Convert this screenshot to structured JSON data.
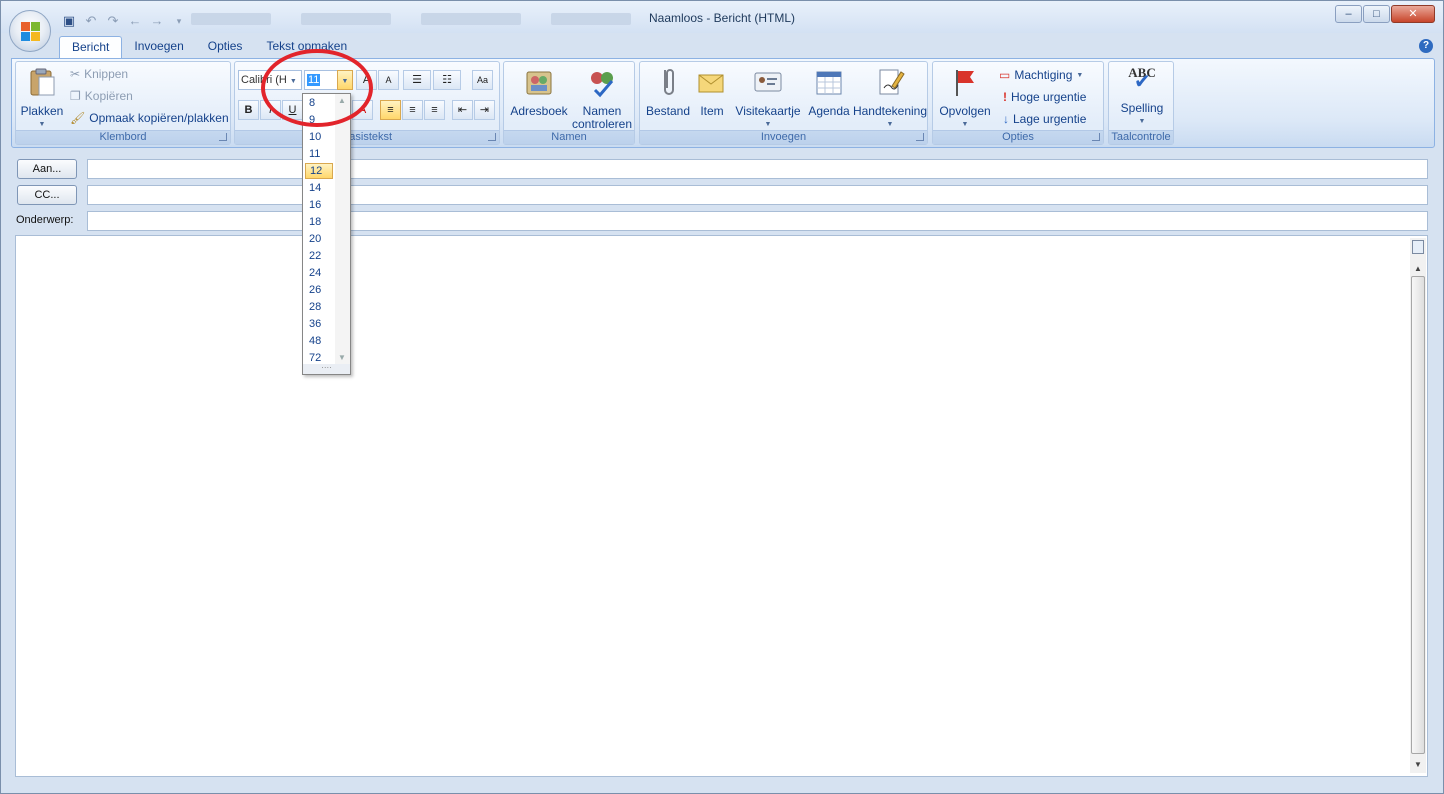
{
  "window": {
    "title": "Naamloos - Bericht (HTML)"
  },
  "quick_access": [
    "save-icon",
    "undo-icon",
    "redo-icon",
    "back-icon",
    "forward-icon",
    "customize-icon"
  ],
  "tabs": [
    {
      "label": "Bericht",
      "active": true
    },
    {
      "label": "Invoegen"
    },
    {
      "label": "Opties"
    },
    {
      "label": "Tekst opmaken"
    }
  ],
  "ribbon": {
    "klembord": {
      "label": "Klembord",
      "paste": "Plakken",
      "cut": "Knippen",
      "copy": "Kopiëren",
      "format_painter": "Opmaak kopiëren/plakken"
    },
    "basistekst": {
      "label": "Basistekst",
      "font": "Calibri (H",
      "font_size": "11"
    },
    "namen": {
      "label": "Namen",
      "adresboek": "Adresboek",
      "namen_line1": "Namen",
      "namen_line2": "controleren"
    },
    "invoegen": {
      "label": "Invoegen",
      "bestand": "Bestand",
      "item": "Item",
      "visitekaartje": "Visitekaartje",
      "agenda": "Agenda",
      "handtekening": "Handtekening"
    },
    "opties": {
      "label": "Opties",
      "opvolgen": "Opvolgen",
      "machtiging": "Machtiging",
      "hoge": "Hoge urgentie",
      "lage": "Lage urgentie"
    },
    "taalcontrole": {
      "label": "Taalcontrole",
      "spelling": "Spelling",
      "abc": "ABC"
    }
  },
  "fields": {
    "aan": "Aan...",
    "cc": "CC...",
    "onderwerp": "Onderwerp:"
  },
  "font_size_dropdown": {
    "options": [
      "8",
      "9",
      "10",
      "11",
      "12",
      "14",
      "16",
      "18",
      "20",
      "22",
      "24",
      "26",
      "28",
      "36",
      "48",
      "72"
    ],
    "highlighted": "12",
    "annotation": "red-circle"
  },
  "colors": {
    "accent": "#15428b",
    "ribbon": "#dce8f7",
    "highlight": "#ffd76b",
    "annotation": "#e2242b"
  }
}
